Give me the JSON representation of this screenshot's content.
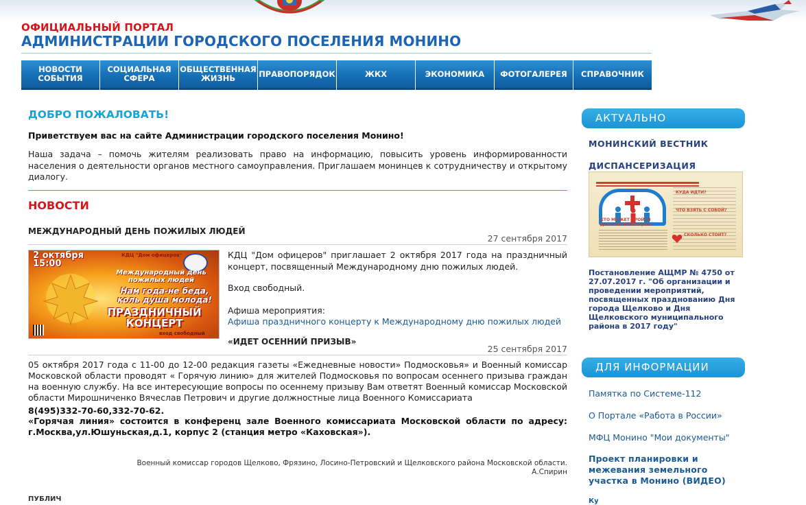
{
  "header": {
    "subtitle": "ОФИЦИАЛЬНЫЙ ПОРТАЛ",
    "title": "АДМИНИСТРАЦИИ ГОРОДСКОГО ПОСЕЛЕНИЯ МОНИНО"
  },
  "nav": {
    "items": [
      {
        "label": "НОВОСТИ\nСОБЫТИЯ"
      },
      {
        "label": "СОЦИАЛЬНАЯ\nСФЕРА"
      },
      {
        "label": "ОБЩЕСТВЕННАЯ\nЖИЗНЬ"
      },
      {
        "label": "ПРАВОПОРЯДОК"
      },
      {
        "label": "ЖКХ"
      },
      {
        "label": "ЭКОНОМИКА"
      },
      {
        "label": "ФОТОГАЛЕРЕЯ"
      },
      {
        "label": "СПРАВОЧНИК"
      }
    ]
  },
  "welcome": {
    "title": "ДОБРО ПОЖАЛОВАТЬ!",
    "greeting": "Приветствуем вас на сайте Администрации городского поселения Монино!",
    "text": "Наша задача – помочь жителям реализовать право на информацию, повысить уровень информированности населения о деятельности органов местного самоуправления. Приглашаем монинцев к сотрудничеству и открытому диалогу."
  },
  "news": {
    "title": "НОВОСТИ",
    "items": [
      {
        "title": "МЕЖДУНАРОДНЫЙ ДЕНЬ ПОЖИЛЫХ ЛЮДЕЙ",
        "date": "27 сентября 2017",
        "body": "КДЦ \"Дом офицеров\" приглашает 2 октября 2017 года на праздничный концерт, посвященный Международному дню пожилых людей.",
        "free_entry": "Вход свободный.",
        "afisha_label": "Афиша мероприятия:",
        "afisha_link": "Афиша праздничного концерту к Международному дню пожилых людей",
        "poster": {
          "date": "2 октября\n15:00",
          "org": "КДЦ \"Дом офицеров\"",
          "event": "Международный день пожилых людей",
          "slogan": "Нам года-не беда, коль душа молода!",
          "concert": "ПРАЗДНИЧНЫЙ КОНЦЕРТ",
          "entry": "вход свободный"
        }
      },
      {
        "title": "«ИДЕТ ОСЕННИЙ ПРИЗЫВ»",
        "date": "25 сентября 2017",
        "body": "05 октября 2017 года с 11-00 до 12-00 редакция газеты «Ежедневные новости» Подмосковья» и Военный комиссар Московской области проводят « Горячую линию» для жителей Подмосковья по вопросам осеннего призыва граждан на военную службу. На все интересующие вопросы по осеннему призыву Вам ответят Военный комиссар Московской области Мирошниченко Вячеслав Петрович и другие должностные лица Военного Комиссариата",
        "phone": "8(495)332-70-60,332-70-62.",
        "hotline": "«Горячая линия» состоится в конференц зале Военного комиссариата Московской области по адресу: г.Москва,ул.Юшуньская,д.1, корпус 2 (станция метро «Каховская»).",
        "signature_line1": "Военный комиссар городов Щелково, Фрязино, Лосино-Петровский и Щелковского района Московской области.",
        "signature_line2": "А.Спирин"
      }
    ],
    "peek_next": "ПУБЛИЧ"
  },
  "sidebar": {
    "actual": {
      "header": "АКТУАЛЬНО",
      "vestnik": "МОНИНСКИЙ ВЕСТНИК",
      "dispanser": "ДИСПАНСЕРИЗАЦИЯ",
      "dispanser_img_texts": {
        "q1": "КУДА ИДТИ?",
        "q2": "ЧТО ВЗЯТЬ С СОБОЙ?",
        "q3": "КТО МОЖЕТ ПРОЙТИ ДИСПАНСЕРИЗАЦИЮ?",
        "q4": "СКОЛЬКО СТОИТ?"
      },
      "postanov": "Постановление АЩМР № 4750 от 27.07.2017 г. \"Об организации и проведении мероприятий, посвященных празднованию Дня города Щелково и Дня Щелковского муниципального района в 2017 году\""
    },
    "info": {
      "header": "ДЛЯ ИНФОРМАЦИИ",
      "links": [
        "Памятка по Системе-112",
        "О Портале «Работа в России»",
        "МФЦ Монино \"Мои документы\""
      ],
      "bold_link": "Проект планировки и межевания земельного участка в Монино (ВИДЕО)",
      "peek": "Ку"
    }
  },
  "colors": {
    "red_accent": "#d4151a",
    "title_blue": "#1c64b4",
    "nav_blue": "#1670b6",
    "welcome_cyan": "#1aa2d6",
    "sidebar_header": "#1c94d5",
    "link_blue": "#1a5a94",
    "side_link_navy": "#27417f"
  }
}
